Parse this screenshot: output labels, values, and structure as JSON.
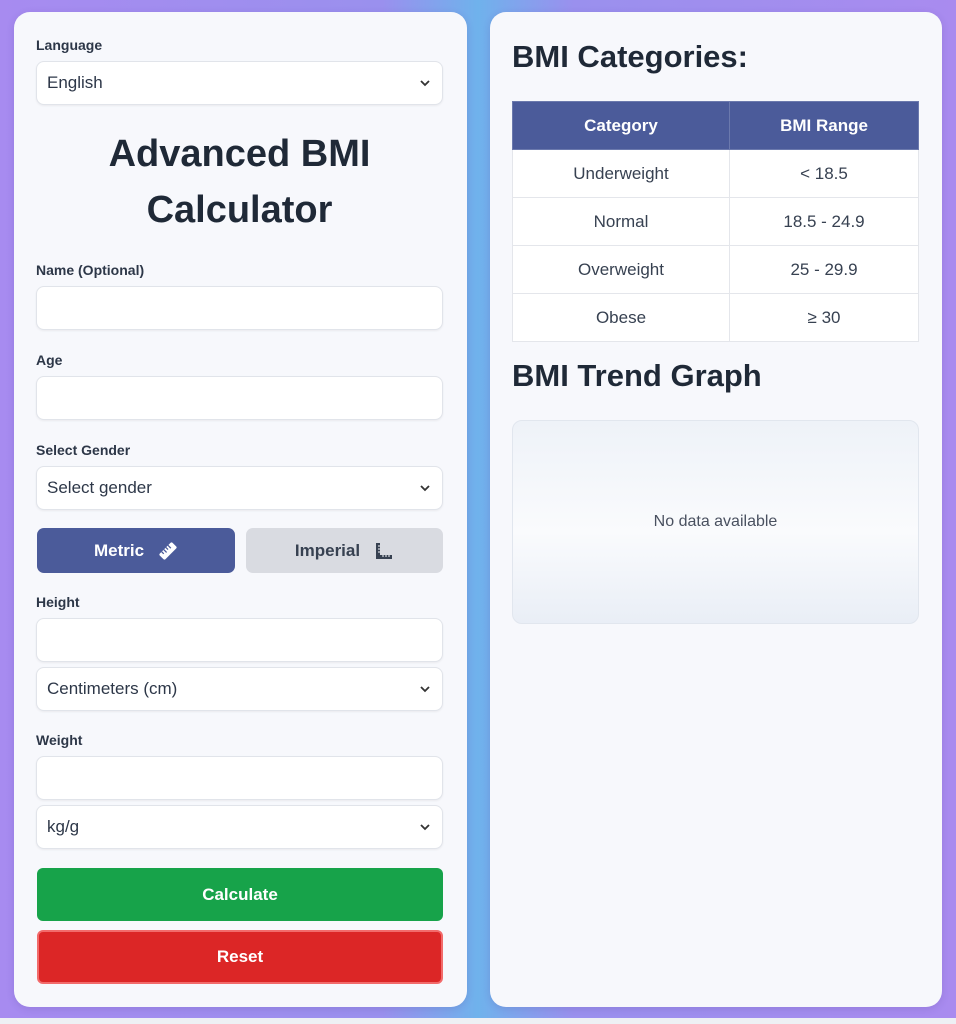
{
  "left_panel": {
    "language_label": "Language",
    "language_value": "English",
    "title": "Advanced BMI Calculator",
    "name_label": "Name (Optional)",
    "name_value": "",
    "age_label": "Age",
    "age_value": "",
    "gender_label": "Select Gender",
    "gender_value": "Select gender",
    "metric_label": "Metric",
    "imperial_label": "Imperial",
    "height_label": "Height",
    "height_value": "",
    "height_unit": "Centimeters (cm)",
    "weight_label": "Weight",
    "weight_value": "",
    "weight_unit": "kg/g",
    "calculate_label": "Calculate",
    "reset_label": "Reset"
  },
  "right_panel": {
    "categories_heading": "BMI Categories:",
    "table_headers": [
      "Category",
      "BMI Range"
    ],
    "table_rows": [
      [
        "Underweight",
        "< 18.5"
      ],
      [
        "Normal",
        "18.5 - 24.9"
      ],
      [
        "Overweight",
        "25 - 29.9"
      ],
      [
        "Obese",
        "≥ 30"
      ]
    ],
    "trend_heading": "BMI Trend Graph",
    "graph_empty_text": "No data available"
  },
  "icons": {
    "metric_icon": "ruler-icon",
    "imperial_icon": "ruler-triangle-icon",
    "select_icon": "chevron-down-icon"
  },
  "colors": {
    "primary": "#4b5b9a",
    "calculate": "#17a34a",
    "reset": "#dc2626"
  }
}
